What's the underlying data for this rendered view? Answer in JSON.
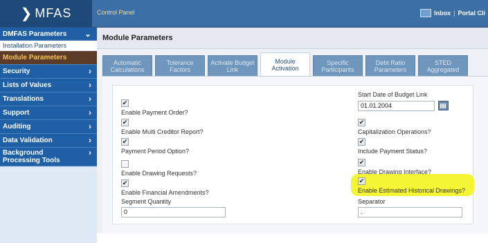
{
  "app": {
    "logo": "MFAS",
    "panel_title": "Control Panel",
    "inbox_label": "Inbox",
    "separator": "|",
    "portal_label": "Portal Cli"
  },
  "sidebar": {
    "header": "DMFAS Parameters",
    "items": [
      {
        "label": "Installation Parameters"
      },
      {
        "label": "Module Parameters"
      },
      {
        "label": "Security"
      },
      {
        "label": "Lists of Values"
      },
      {
        "label": "Translations"
      },
      {
        "label": "Support"
      },
      {
        "label": "Auditing"
      },
      {
        "label": "Data Validation"
      },
      {
        "label": "Background Processing Tools"
      }
    ]
  },
  "main": {
    "title": "Module Parameters",
    "tabs": [
      {
        "label": "Automatic Calculations"
      },
      {
        "label": "Tolerance Factors"
      },
      {
        "label": "Activate Budget Link"
      },
      {
        "label": "Module Activation"
      },
      {
        "label": "Specific Participants"
      },
      {
        "label": "Debt Ratio Parameters"
      },
      {
        "label": "STED Aggregated"
      }
    ],
    "left_fields": [
      {
        "label": "Enable Payment Order?",
        "checked": true
      },
      {
        "label": "Enable Multi Creditor Report?",
        "checked": true
      },
      {
        "label": "Payment Period Option?",
        "checked": true
      },
      {
        "label": "Enable Drawing Requests?",
        "checked": false
      },
      {
        "label": "Enable Financial Amendments?",
        "checked": true
      }
    ],
    "segment_quantity": {
      "label": "Segment Quantity",
      "value": "0"
    },
    "start_date": {
      "label": "Start Date of Budget Link",
      "value": "01.01.2004"
    },
    "right_fields": [
      {
        "label": "Capitalization Operations?",
        "checked": true
      },
      {
        "label": "Include Payment Status?",
        "checked": true
      },
      {
        "label": "Enable Drawing Interface?",
        "checked": true
      },
      {
        "label": "Enable Estimated Historical Drawings?",
        "checked": true
      }
    ],
    "separator_field": {
      "label": "Separator",
      "value": "."
    },
    "check_glyph": "✔",
    "highlight_color": "#f3f52a"
  }
}
